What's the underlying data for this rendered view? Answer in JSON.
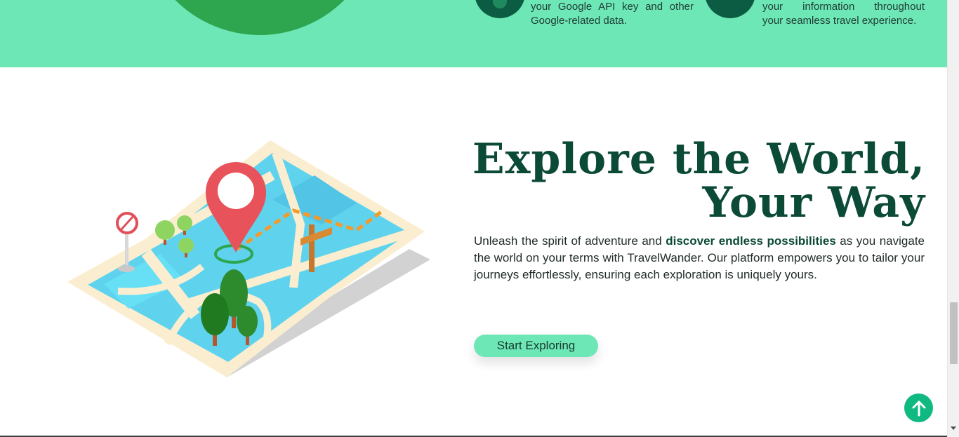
{
  "features": [
    {
      "icon": "key-icon",
      "line1": "your Google API key and other",
      "line2": "Google-related data."
    },
    {
      "icon": "shield-icon",
      "line1": "your information throughout",
      "line2": "your seamless travel experience."
    }
  ],
  "hero": {
    "title_line1": "Explore the World,",
    "title_line2": "Your Way",
    "desc_before": "Unleash the spirit of adventure and ",
    "desc_bold": "discover endless possibilities",
    "desc_after": " as you navigate the world on your terms with TravelWander. Our platform empowers you to tailor your journeys effortlessly, ensuring each exploration is uniquely yours.",
    "cta_label": "Start Exploring"
  },
  "scroll_top": {
    "icon": "arrow-up-icon"
  },
  "colors": {
    "band": "#6ee7b7",
    "heading": "#0b4a37",
    "cta": "#6ee7b7",
    "scroll_top": "#10b981"
  }
}
